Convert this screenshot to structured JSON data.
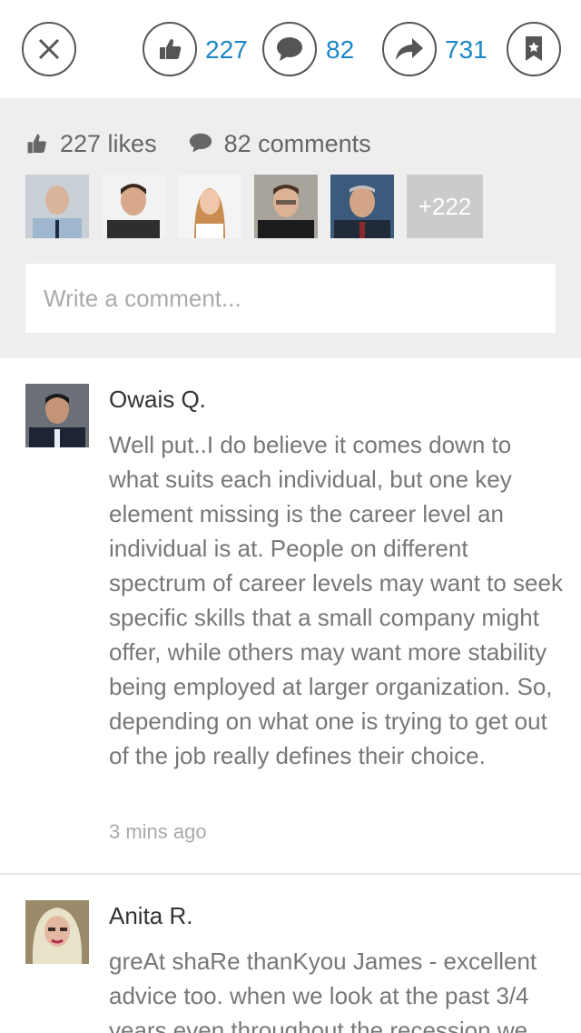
{
  "toolbar": {
    "likes_count": "227",
    "comments_count": "82",
    "shares_count": "731"
  },
  "summary": {
    "likes_text": "227 likes",
    "comments_text": "82 comments",
    "more_likers": "+222"
  },
  "comment_box": {
    "placeholder": "Write a comment..."
  },
  "comments": [
    {
      "author": "Owais Q.",
      "text": "Well put..I do believe it comes down to what suits each individual, but one key element missing is the career level an individual is at. People on different spectrum of career levels may want to seek specific skills that a small company might offer, while others may want more stability being employed at larger organization. So, depending on what one is trying to get out of the job really defines their choice.",
      "time": "3 mins ago"
    },
    {
      "author": "Anita R.",
      "text": "greAt shaRe thanKyou James - excellent advice too. when we look at the past 3/4 years even throughout the recession we"
    }
  ],
  "colors": {
    "accent": "#1c87c9",
    "summary_bg": "#eeeeee",
    "muted_text": "#777777"
  }
}
